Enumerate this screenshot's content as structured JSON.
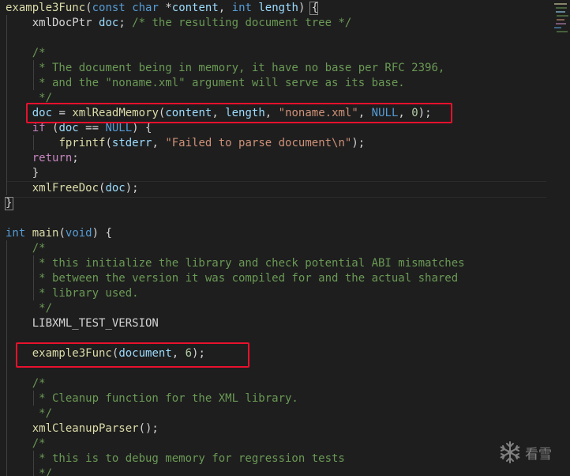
{
  "editor": {
    "lines": [
      [
        {
          "t": "example3Func",
          "c": "fn"
        },
        {
          "t": "(",
          "c": "pl"
        },
        {
          "t": "const",
          "c": "kw"
        },
        {
          "t": " ",
          "c": "pl"
        },
        {
          "t": "char",
          "c": "kw"
        },
        {
          "t": " *",
          "c": "pl"
        },
        {
          "t": "content",
          "c": "var"
        },
        {
          "t": ", ",
          "c": "pl"
        },
        {
          "t": "int",
          "c": "kw"
        },
        {
          "t": " ",
          "c": "pl"
        },
        {
          "t": "length",
          "c": "var"
        },
        {
          "t": ") {",
          "c": "pl"
        }
      ],
      [
        {
          "t": "    xmlDocPtr ",
          "c": "pl"
        },
        {
          "t": "doc",
          "c": "var"
        },
        {
          "t": "; ",
          "c": "pl"
        },
        {
          "t": "/* the resulting document tree */",
          "c": "cmt"
        }
      ],
      [],
      [
        {
          "t": "    /*",
          "c": "cmt"
        }
      ],
      [
        {
          "t": "     * The document being in memory, it have no base per RFC 2396,",
          "c": "cmt"
        }
      ],
      [
        {
          "t": "     * and the \"noname.xml\" argument will serve as its base.",
          "c": "cmt"
        }
      ],
      [
        {
          "t": "     */",
          "c": "cmt"
        }
      ],
      [
        {
          "t": "    ",
          "c": "pl"
        },
        {
          "t": "doc",
          "c": "var"
        },
        {
          "t": " = ",
          "c": "pl"
        },
        {
          "t": "xmlReadMemory",
          "c": "fn"
        },
        {
          "t": "(",
          "c": "pl"
        },
        {
          "t": "content",
          "c": "var"
        },
        {
          "t": ", ",
          "c": "pl"
        },
        {
          "t": "length",
          "c": "var"
        },
        {
          "t": ", ",
          "c": "pl"
        },
        {
          "t": "\"noname.xml\"",
          "c": "str"
        },
        {
          "t": ", ",
          "c": "pl"
        },
        {
          "t": "NULL",
          "c": "kw"
        },
        {
          "t": ", ",
          "c": "pl"
        },
        {
          "t": "0",
          "c": "num"
        },
        {
          "t": ");",
          "c": "pl"
        }
      ],
      [
        {
          "t": "    ",
          "c": "pl"
        },
        {
          "t": "if",
          "c": "ctl"
        },
        {
          "t": " (",
          "c": "pl"
        },
        {
          "t": "doc",
          "c": "var"
        },
        {
          "t": " == ",
          "c": "pl"
        },
        {
          "t": "NULL",
          "c": "kw"
        },
        {
          "t": ") {",
          "c": "pl"
        }
      ],
      [
        {
          "t": "        ",
          "c": "pl"
        },
        {
          "t": "fprintf",
          "c": "fn"
        },
        {
          "t": "(",
          "c": "pl"
        },
        {
          "t": "stderr",
          "c": "var"
        },
        {
          "t": ", ",
          "c": "pl"
        },
        {
          "t": "\"Failed to parse document\\n\"",
          "c": "str"
        },
        {
          "t": ");",
          "c": "pl"
        }
      ],
      [
        {
          "t": "    ",
          "c": "pl"
        },
        {
          "t": "return",
          "c": "ctl"
        },
        {
          "t": ";",
          "c": "pl"
        }
      ],
      [
        {
          "t": "    }",
          "c": "pl"
        }
      ],
      [
        {
          "t": "    ",
          "c": "pl"
        },
        {
          "t": "xmlFreeDoc",
          "c": "fn"
        },
        {
          "t": "(",
          "c": "pl"
        },
        {
          "t": "doc",
          "c": "var"
        },
        {
          "t": ");",
          "c": "pl"
        }
      ],
      [
        {
          "t": "}",
          "c": "pl"
        }
      ],
      [],
      [
        {
          "t": "int",
          "c": "kw"
        },
        {
          "t": " ",
          "c": "pl"
        },
        {
          "t": "main",
          "c": "fn"
        },
        {
          "t": "(",
          "c": "pl"
        },
        {
          "t": "void",
          "c": "kw"
        },
        {
          "t": ") {",
          "c": "pl"
        }
      ],
      [
        {
          "t": "    /*",
          "c": "cmt"
        }
      ],
      [
        {
          "t": "     * this initialize the library and check potential ABI mismatches",
          "c": "cmt"
        }
      ],
      [
        {
          "t": "     * between the version it was compiled for and the actual shared",
          "c": "cmt"
        }
      ],
      [
        {
          "t": "     * library used.",
          "c": "cmt"
        }
      ],
      [
        {
          "t": "     */",
          "c": "cmt"
        }
      ],
      [
        {
          "t": "    LIBXML_TEST_VERSION",
          "c": "pl"
        }
      ],
      [],
      [
        {
          "t": "    ",
          "c": "pl"
        },
        {
          "t": "example3Func",
          "c": "fn"
        },
        {
          "t": "(",
          "c": "pl"
        },
        {
          "t": "document",
          "c": "var"
        },
        {
          "t": ", ",
          "c": "pl"
        },
        {
          "t": "6",
          "c": "num"
        },
        {
          "t": ");",
          "c": "pl"
        }
      ],
      [],
      [
        {
          "t": "    /*",
          "c": "cmt"
        }
      ],
      [
        {
          "t": "     * Cleanup function for the XML library.",
          "c": "cmt"
        }
      ],
      [
        {
          "t": "     */",
          "c": "cmt"
        }
      ],
      [
        {
          "t": "    ",
          "c": "pl"
        },
        {
          "t": "xmlCleanupParser",
          "c": "fn"
        },
        {
          "t": "();",
          "c": "pl"
        }
      ],
      [
        {
          "t": "    /*",
          "c": "cmt"
        }
      ],
      [
        {
          "t": "     * this is to debug memory for regression tests",
          "c": "cmt"
        }
      ],
      [
        {
          "t": "     */",
          "c": "cmt"
        }
      ]
    ]
  },
  "watermark": {
    "icon": "snowflake-icon",
    "label": "看雪"
  },
  "colors": {
    "background": "#1e1e1e",
    "highlight_box": "#e8112d",
    "keyword": "#569cd6",
    "control": "#c586c0",
    "function": "#dcdcaa",
    "variable": "#9cdcfe",
    "string": "#ce9178",
    "number": "#b5cea8",
    "comment": "#6a9955"
  }
}
